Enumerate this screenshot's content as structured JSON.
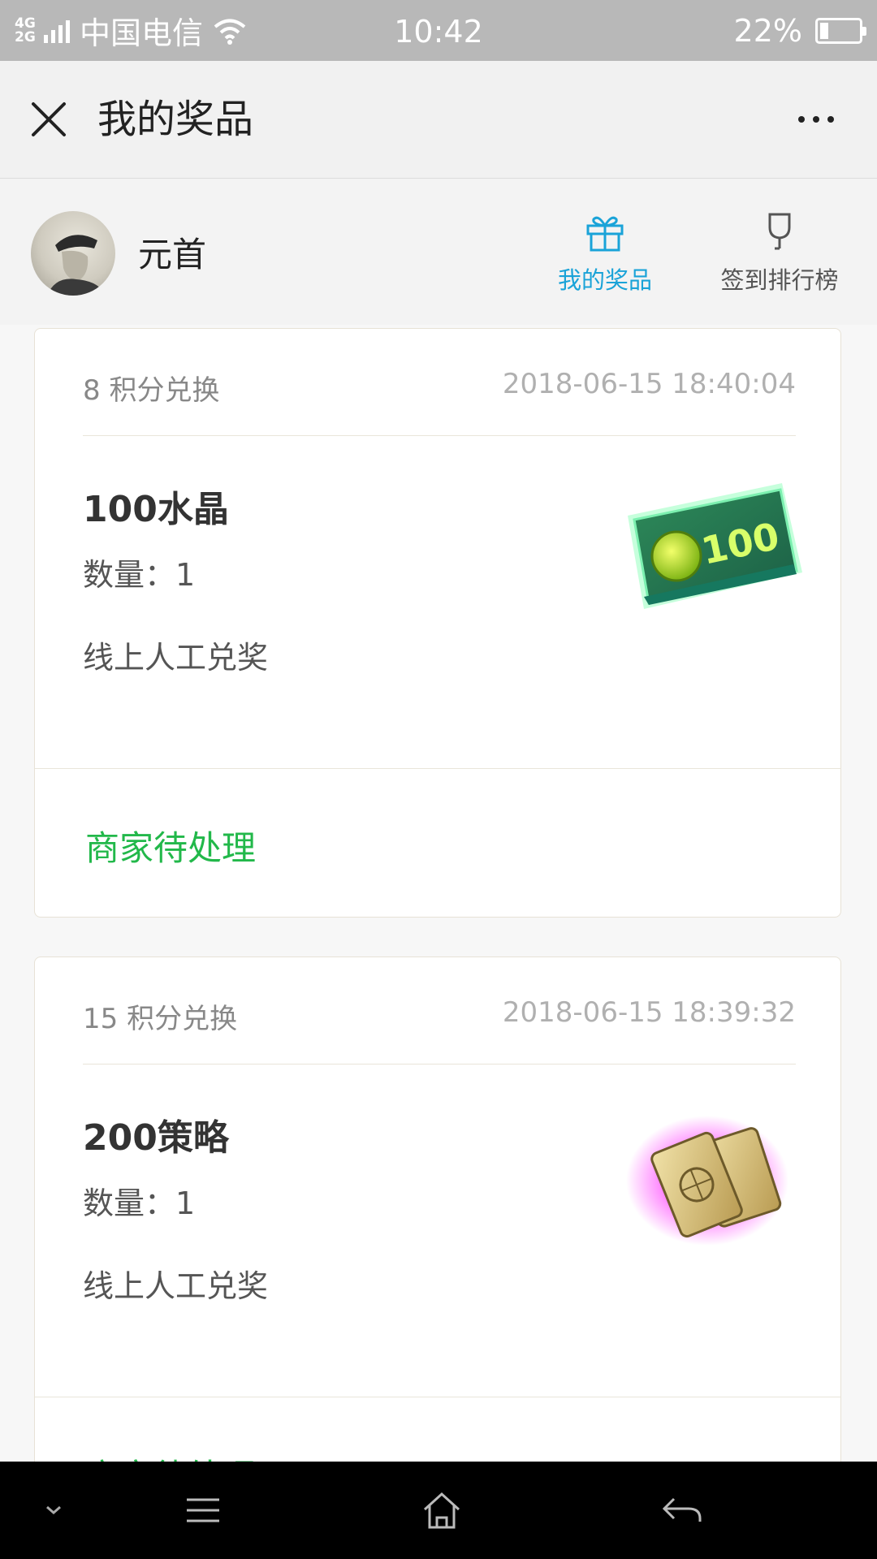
{
  "status_bar": {
    "network": "4G\n2G",
    "carrier": "中国电信",
    "time": "10:42",
    "battery_percent": "22%",
    "battery_level": 0.22
  },
  "header": {
    "title": "我的奖品"
  },
  "profile": {
    "username": "元首",
    "tabs": [
      {
        "label": "我的奖品",
        "icon": "gift-icon",
        "active": true
      },
      {
        "label": "签到排行榜",
        "icon": "trophy-icon",
        "active": false
      }
    ]
  },
  "prizes": [
    {
      "points": "8 积分兑换",
      "datetime": "2018-06-15 18:40:04",
      "name": "100水晶",
      "quantity": "数量：1",
      "method": "线上人工兑奖",
      "status": "商家待处理",
      "image": "crystal-100-ticket"
    },
    {
      "points": "15 积分兑换",
      "datetime": "2018-06-15 18:39:32",
      "name": "200策略",
      "quantity": "数量：1",
      "method": "线上人工兑奖",
      "status": "商家待处理",
      "image": "strategy-cards"
    }
  ],
  "colors": {
    "accent_blue": "#1aa3d8",
    "status_green": "#22b84a",
    "status_bar": "#b8b8b8"
  }
}
